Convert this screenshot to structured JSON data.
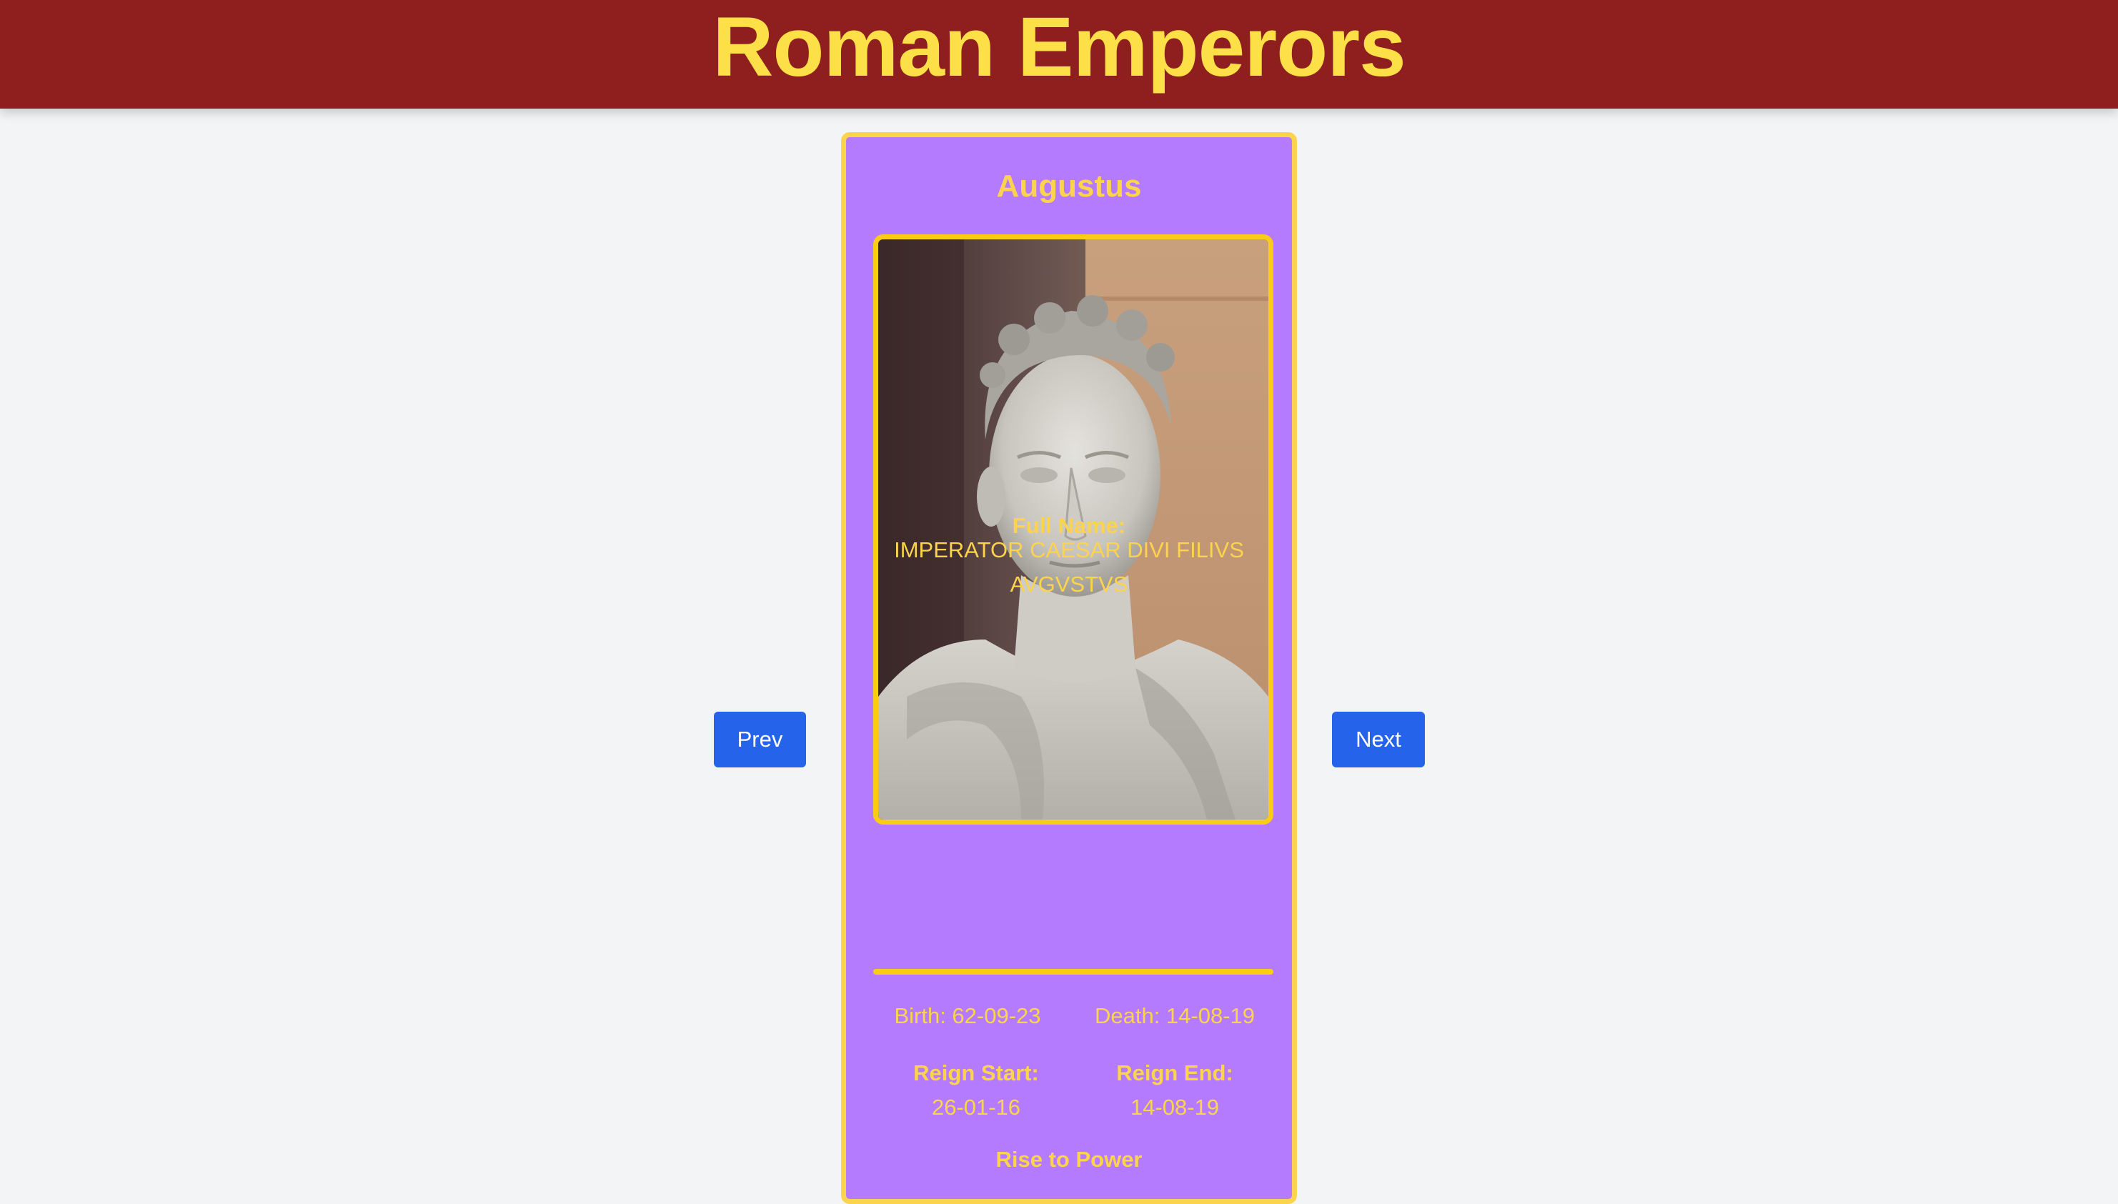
{
  "app": {
    "title": "Roman Emperors"
  },
  "nav": {
    "prev_label": "Prev",
    "next_label": "Next"
  },
  "emperor": {
    "name": "Augustus",
    "portrait_alt": "Marble bust of Augustus",
    "full_name_label": "Full Name:",
    "full_name_line1": "IMPERATOR CAESAR DIVI FILIVS",
    "full_name_line2": "AVGVSTVS",
    "birth": "Birth: 62-09-23",
    "death": "Death: 14-08-19",
    "reign_start_label": "Reign Start:",
    "reign_start": "26-01-16",
    "reign_end_label": "Reign End:",
    "reign_end": "14-08-19",
    "rise_to_power_label": "Rise to Power"
  },
  "colors": {
    "header_bg": "#8f1f1f",
    "title": "#fde047",
    "card_bg": "#b57bff",
    "card_text": "#fcd34d",
    "button_bg": "#2563eb",
    "page_bg": "#f3f4f6"
  }
}
